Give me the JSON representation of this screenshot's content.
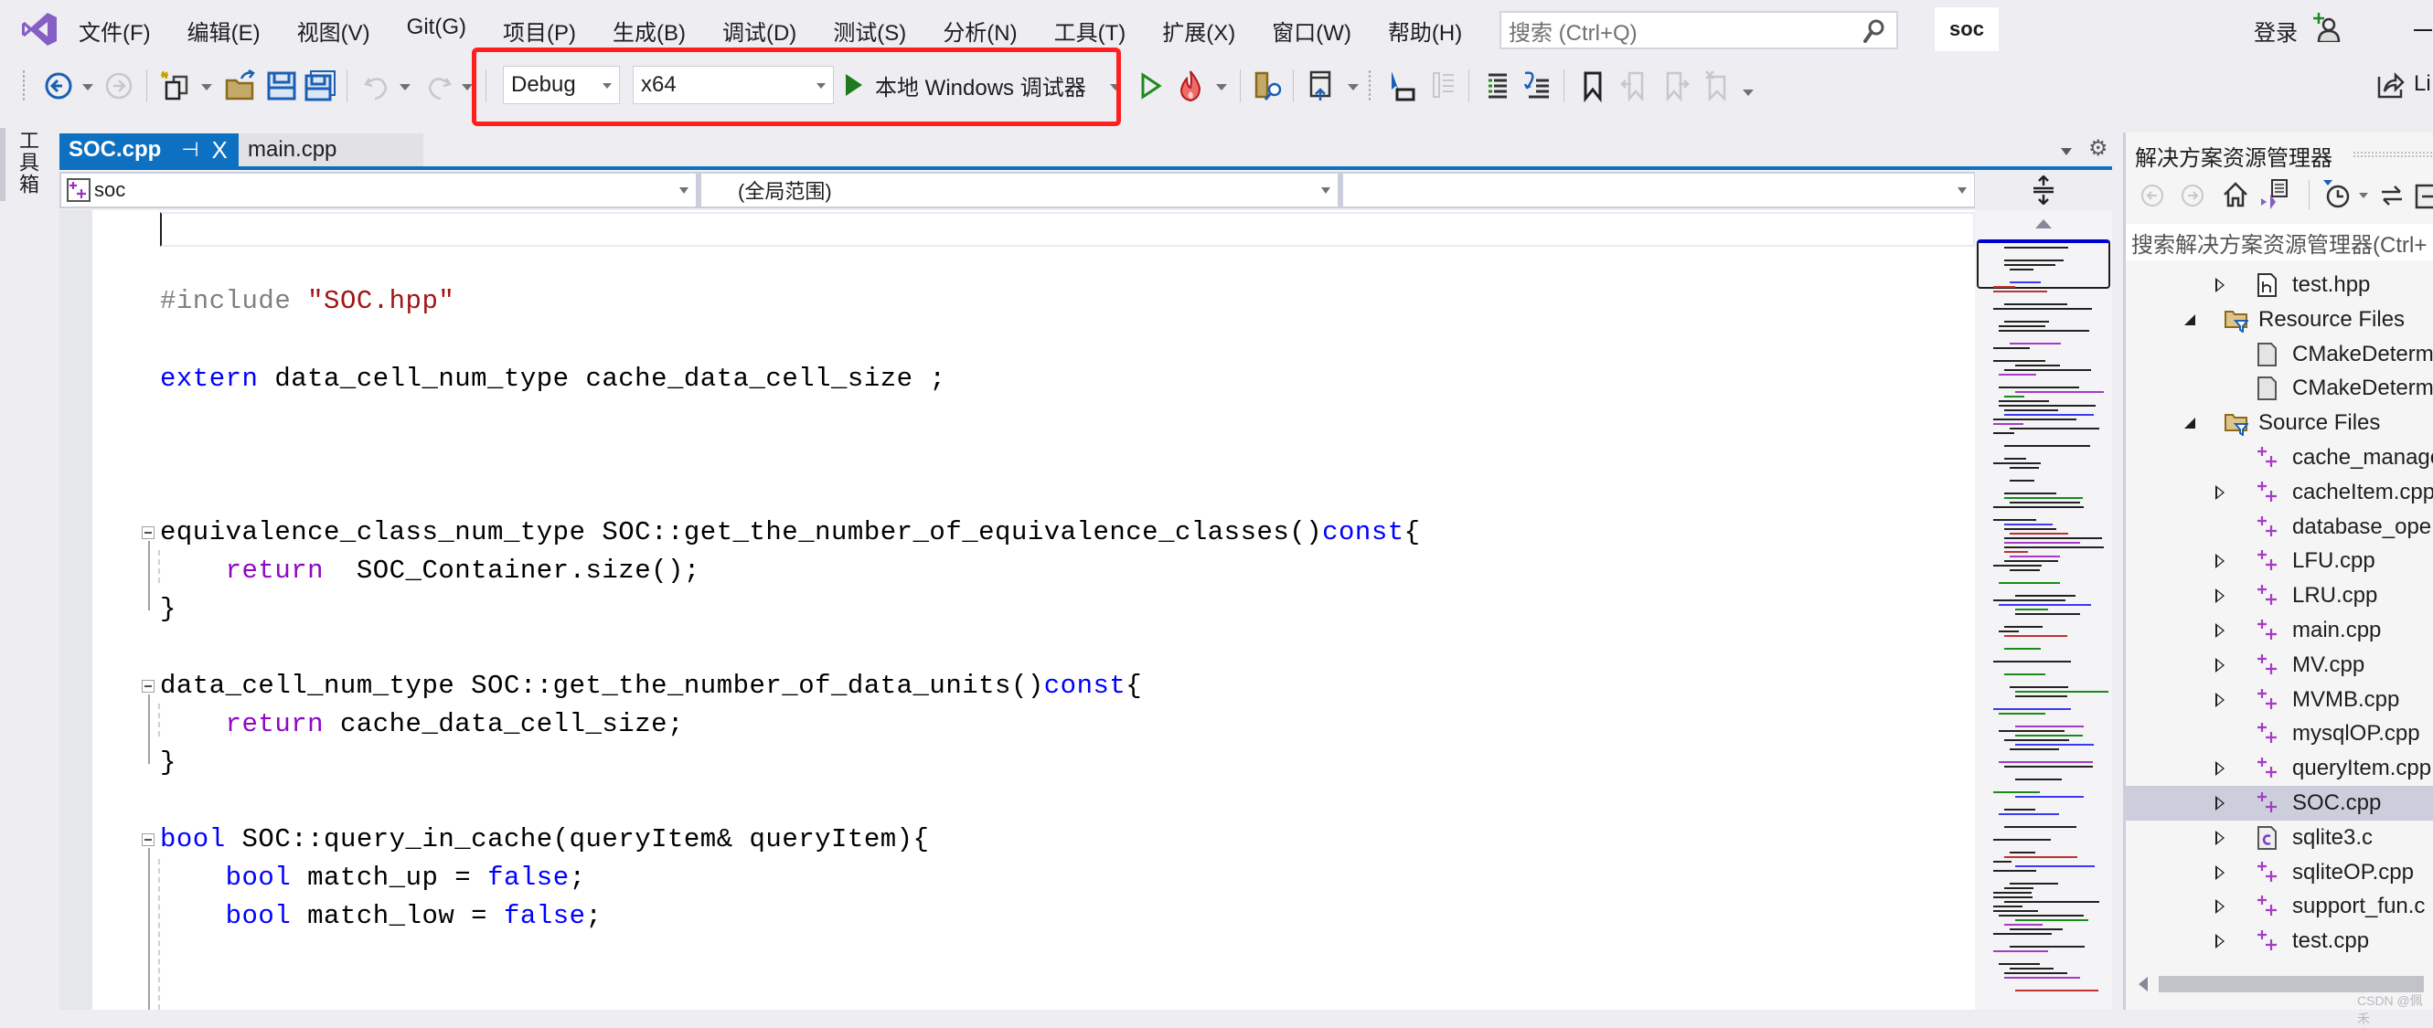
{
  "titlebar": {
    "menu": [
      "文件(F)",
      "编辑(E)",
      "视图(V)",
      "Git(G)",
      "项目(P)",
      "生成(B)",
      "调试(D)",
      "测试(S)",
      "分析(N)",
      "工具(T)",
      "扩展(X)",
      "窗口(W)",
      "帮助(H)"
    ],
    "search_placeholder": "搜索 (Ctrl+Q)",
    "solution_name": "soc",
    "login": "登录"
  },
  "toolbar": {
    "configuration": "Debug",
    "platform": "x64",
    "run_label": "本地 Windows 调试器",
    "live_share": "Li",
    "highlight_color": "#ff1f1f"
  },
  "toolbox": {
    "label": "工具箱"
  },
  "tabs": [
    {
      "label": "SOC.cpp",
      "active": true,
      "pin": "⊣",
      "close": "X"
    },
    {
      "label": "main.cpp",
      "active": false
    }
  ],
  "navbar": {
    "project": "soc",
    "scope": "(全局范围)",
    "member": ""
  },
  "editor": {
    "lines": [
      {
        "tokens": [
          [
            "pp",
            "#include "
          ],
          [
            "str",
            "\"SOC.hpp\""
          ]
        ]
      },
      {
        "tokens": [
          [
            "kw",
            "extern"
          ],
          [
            "",
            " data_cell_num_type cache_data_cell_size ;"
          ]
        ]
      },
      {
        "tokens": [
          [
            "",
            "equivalence_class_num_type SOC::get_the_number_of_equivalence_classes()"
          ],
          [
            "kw",
            "const"
          ],
          [
            "",
            "{"
          ]
        ]
      },
      {
        "tokens": [
          [
            "",
            "    "
          ],
          [
            "kw2",
            "return"
          ],
          [
            "",
            "  SOC_Container.size();"
          ]
        ]
      },
      {
        "tokens": [
          [
            "",
            "}"
          ]
        ]
      },
      {
        "tokens": [
          [
            "",
            "data_cell_num_type SOC::get_the_number_of_data_units()"
          ],
          [
            "kw",
            "const"
          ],
          [
            "",
            "{"
          ]
        ]
      },
      {
        "tokens": [
          [
            "",
            "    "
          ],
          [
            "kw2",
            "return"
          ],
          [
            "",
            " cache_data_cell_size;"
          ]
        ]
      },
      {
        "tokens": [
          [
            "",
            "}"
          ]
        ]
      },
      {
        "tokens": [
          [
            "kw",
            "bool"
          ],
          [
            "",
            " SOC::query_in_cache(queryItem& queryItem){"
          ]
        ]
      },
      {
        "tokens": [
          [
            "",
            "    "
          ],
          [
            "kw",
            "bool"
          ],
          [
            "",
            " match_up = "
          ],
          [
            "kw",
            "false"
          ],
          [
            "",
            ";"
          ]
        ]
      },
      {
        "tokens": [
          [
            "",
            "    "
          ],
          [
            "kw",
            "bool"
          ],
          [
            "",
            " match_low = "
          ],
          [
            "kw",
            "false"
          ],
          [
            "",
            ";"
          ]
        ]
      }
    ]
  },
  "solution_explorer": {
    "title": "解决方案资源管理器",
    "search_placeholder": "搜索解决方案资源管理器(Ctrl+",
    "items": [
      {
        "label": "test.hpp",
        "icon": "header-file-icon",
        "arrow": "collapsed",
        "selected": false
      },
      {
        "label": "Resource Files",
        "icon": "filter-folder-icon",
        "arrow": "expanded",
        "selected": false
      },
      {
        "label": "CMakeDeterm",
        "icon": "file-icon",
        "arrow": "none",
        "selected": false
      },
      {
        "label": "CMakeDeterm",
        "icon": "file-icon",
        "arrow": "none",
        "selected": false
      },
      {
        "label": "Source Files",
        "icon": "filter-folder-icon",
        "arrow": "expanded",
        "selected": false
      },
      {
        "label": "cache_manage",
        "icon": "cpp-file-icon",
        "arrow": "none",
        "selected": false
      },
      {
        "label": "cacheItem.cpp",
        "icon": "cpp-file-icon",
        "arrow": "collapsed",
        "selected": false
      },
      {
        "label": "database_ope",
        "icon": "cpp-file-icon",
        "arrow": "none",
        "selected": false
      },
      {
        "label": "LFU.cpp",
        "icon": "cpp-file-icon",
        "arrow": "collapsed",
        "selected": false
      },
      {
        "label": "LRU.cpp",
        "icon": "cpp-file-icon",
        "arrow": "collapsed",
        "selected": false
      },
      {
        "label": "main.cpp",
        "icon": "cpp-file-icon",
        "arrow": "collapsed",
        "selected": false
      },
      {
        "label": "MV.cpp",
        "icon": "cpp-file-icon",
        "arrow": "collapsed",
        "selected": false
      },
      {
        "label": "MVMB.cpp",
        "icon": "cpp-file-icon",
        "arrow": "collapsed",
        "selected": false
      },
      {
        "label": "mysqlOP.cpp",
        "icon": "cpp-file-icon",
        "arrow": "none",
        "selected": false
      },
      {
        "label": "queryItem.cpp",
        "icon": "cpp-file-icon",
        "arrow": "collapsed",
        "selected": false
      },
      {
        "label": "SOC.cpp",
        "icon": "cpp-file-icon",
        "arrow": "collapsed",
        "selected": true
      },
      {
        "label": "sqlite3.c",
        "icon": "c-file-icon",
        "arrow": "collapsed",
        "selected": false
      },
      {
        "label": "sqliteOP.cpp",
        "icon": "cpp-file-icon",
        "arrow": "collapsed",
        "selected": false
      },
      {
        "label": "support_fun.c",
        "icon": "cpp-file-icon",
        "arrow": "collapsed",
        "selected": false
      },
      {
        "label": "test.cpp",
        "icon": "cpp-file-icon",
        "arrow": "collapsed",
        "selected": false
      }
    ]
  },
  "watermark": "CSDN @佩禾"
}
